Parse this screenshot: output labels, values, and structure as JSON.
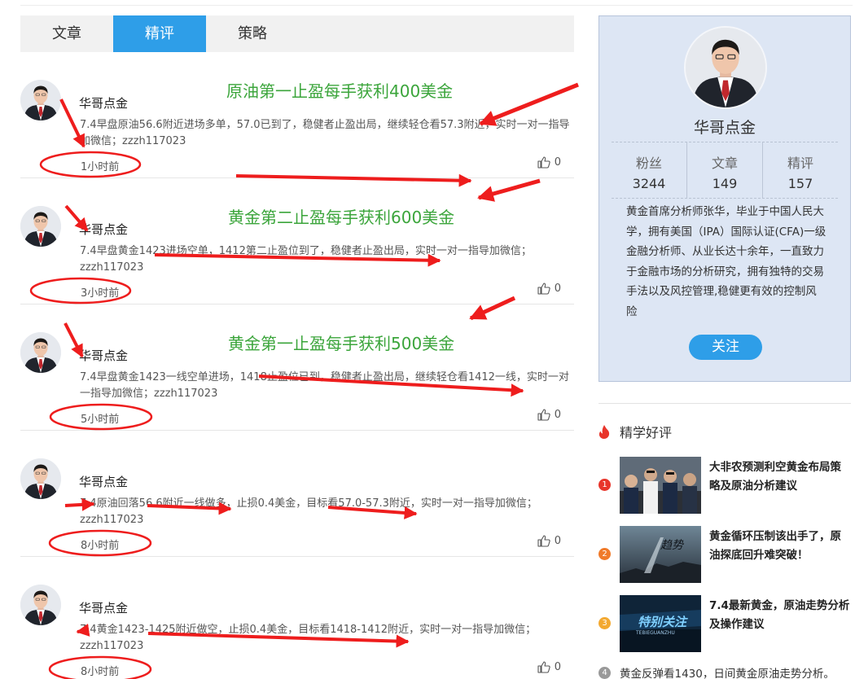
{
  "tabs": [
    {
      "label": "文章",
      "active": false
    },
    {
      "label": "精评",
      "active": true
    },
    {
      "label": "策略",
      "active": false
    }
  ],
  "posts": [
    {
      "author": "华哥点金",
      "headline": "原油第一止盈每手获利400美金",
      "content": "7.4早盘原油56.6附近进场多单，57.0已到了，稳健者止盈出局，继续轻仓看57.3附近，实时一对一指导加微信；zzzh117023",
      "time": "1小时前",
      "likes": "0"
    },
    {
      "author": "华哥点金",
      "headline": "黄金第二止盈每手获利600美金",
      "content": "7.4早盘黄金1423进场空单，1412第二止盈位到了，稳健者止盈出局，实时一对一指导加微信；zzzh117023",
      "time": "3小时前",
      "likes": "0"
    },
    {
      "author": "华哥点金",
      "headline": "黄金第一止盈每手获利500美金",
      "content": "7.4早盘黄金1423一线空单进场，1418止盈位已到，稳健者止盈出局，继续轻仓看1412一线，实时一对一指导加微信；zzzh117023",
      "time": "5小时前",
      "likes": "0"
    },
    {
      "author": "华哥点金",
      "headline": "",
      "content": "7.4原油回落56.6附近一线做多，止损0.4美金，目标看57.0-57.3附近，实时一对一指导加微信；zzzh117023",
      "time": "8小时前",
      "likes": "0"
    },
    {
      "author": "华哥点金",
      "headline": "",
      "content": "7.4黄金1423-1425附近做空，止损0.4美金，目标看1418-1412附近，实时一对一指导加微信；zzzh117023",
      "time": "8小时前",
      "likes": "0"
    }
  ],
  "profile": {
    "name": "华哥点金",
    "stats": [
      {
        "label": "粉丝",
        "value": "3244"
      },
      {
        "label": "文章",
        "value": "149"
      },
      {
        "label": "精评",
        "value": "157"
      }
    ],
    "bio": "黄金首席分析师张华，毕业于中国人民大学，拥有美国（IPA）国际认证(CFA)一级金融分析师、从业长达十余年，一直致力于金融市场的分析研究，拥有独特的交易手法以及风控管理,稳健更有效的控制风险",
    "follow_label": "关注"
  },
  "section": {
    "title": "精学好评",
    "items": [
      {
        "num": "1",
        "title": "大非农预测利空黄金布局策略及原油分析建议",
        "color": "#e8352b"
      },
      {
        "num": "2",
        "title": "黄金循环压制该出手了，原油探底回升难突破！",
        "color": "#f07a2a"
      },
      {
        "num": "3",
        "title": "7.4最新黄金，原油走势分析及操作建议",
        "color": "#f3a931"
      },
      {
        "num": "4",
        "title": "黄金反弹看1430，日间黄金原油走势分析。",
        "color": "#999999"
      }
    ]
  },
  "thumb_texts": {
    "item2": "趋势",
    "item3_main": "特别关注",
    "item3_sub": "TEBIEGUANZHU"
  },
  "colors": {
    "accent": "#2e9ee8",
    "headline": "#3ba53b",
    "annotation": "#ee1d1d",
    "profile_bg": "#dde6f4"
  },
  "icons": {
    "like": "thumbs-up-icon",
    "fire": "flame-icon"
  }
}
